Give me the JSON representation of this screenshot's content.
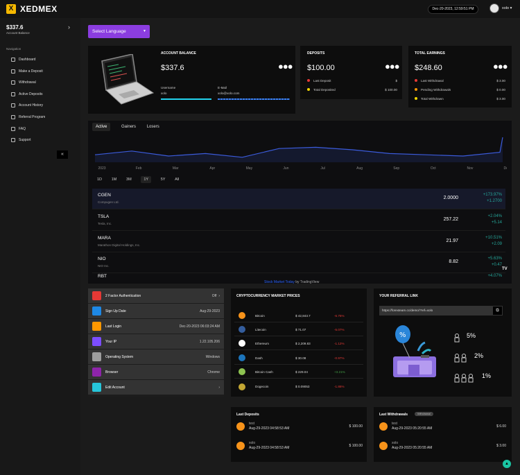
{
  "brand": {
    "name": "XEDMEX",
    "logo_letter": "X"
  },
  "header": {
    "datetime": "Dec-20-2023, 12:59:51 PM",
    "username": "xolo",
    "caret": "▾"
  },
  "sidebar": {
    "balance": "$337.6",
    "balance_label": "Account Balance",
    "nav_heading": "Navigation",
    "items": [
      {
        "label": "Dashboard",
        "icon": "dashboard-icon"
      },
      {
        "label": "Make a Deposit",
        "icon": "deposit-icon"
      },
      {
        "label": "Withdrawal",
        "icon": "withdrawal-icon"
      },
      {
        "label": "Active Deposits",
        "icon": "active-deposits-icon"
      },
      {
        "label": "Account History",
        "icon": "history-icon"
      },
      {
        "label": "Referral Program",
        "icon": "referral-icon"
      },
      {
        "label": "FAQ",
        "icon": "faq-icon"
      },
      {
        "label": "Support",
        "icon": "support-icon"
      }
    ],
    "collapse": "«"
  },
  "language": {
    "label": "Select Language"
  },
  "account_card": {
    "title": "ACCOUNT BALANCE",
    "amount": "$337.6",
    "user_label": "Username",
    "user_value": "xolo",
    "email_label": "E-Mail",
    "email_value": "xolo@xolo.com"
  },
  "deposits_card": {
    "title": "DEPOSITS",
    "amount": "$100.00",
    "rows": [
      {
        "label": "Last Deposit",
        "value": "$",
        "color": "#e53935"
      },
      {
        "label": "Total Deposited",
        "value": "$ 100.00",
        "color": "#f5d800"
      }
    ]
  },
  "earnings_card": {
    "title": "TOTAL EARNINGS",
    "amount": "$248.60",
    "rows": [
      {
        "label": "Last Withdrawal",
        "value": "$ 3.00",
        "color": "#e53935"
      },
      {
        "label": "Pending Withdrawals",
        "value": "$ 0.00",
        "color": "#ff9800"
      },
      {
        "label": "Total Withdrawn",
        "value": "$ 3.00",
        "color": "#f5d800"
      }
    ]
  },
  "market": {
    "tabs": [
      "Active",
      "Gainers",
      "Losers"
    ],
    "months": [
      "2023",
      "Feb",
      "Mar",
      "Apr",
      "May",
      "Jun",
      "Jul",
      "Aug",
      "Sep",
      "Oct",
      "Nov",
      "Dec"
    ],
    "ranges": [
      "1D",
      "1M",
      "3M",
      "1Y",
      "5Y",
      "All"
    ],
    "stocks": [
      {
        "symbol": "CGEN",
        "name": "Compugen Ltd.",
        "price": "2.0000",
        "pct": "+173.97%",
        "chg": "+1.2700"
      },
      {
        "symbol": "TSLA",
        "name": "Tesla, Inc.",
        "price": "257.22",
        "pct": "+2.04%",
        "chg": "+5.14"
      },
      {
        "symbol": "MARA",
        "name": "Marathon Digital Holdings, Inc.",
        "price": "21.97",
        "pct": "+10.51%",
        "chg": "+2.09"
      },
      {
        "symbol": "NIO",
        "name": "NIO Inc.",
        "price": "8.82",
        "pct": "+5.63%",
        "chg": "+0.47"
      },
      {
        "symbol": "RBT",
        "name": "",
        "price": "",
        "pct": "+4.07%",
        "chg": ""
      }
    ],
    "footer_link": "Stock Market Today",
    "footer_by": "by TradingView"
  },
  "chart_data": {
    "type": "area",
    "x": [
      "2023",
      "Feb",
      "Mar",
      "Apr",
      "May",
      "Jun",
      "Jul",
      "Aug",
      "Sep",
      "Oct",
      "Nov",
      "Dec"
    ],
    "series": [
      {
        "values": [
          0.3,
          0.45,
          0.25,
          0.35,
          0.2,
          0.55,
          0.6,
          0.5,
          0.35,
          0.3,
          0.25,
          0.4
        ]
      }
    ],
    "end_spike": 1.0,
    "color": "#3b5bdb"
  },
  "info": [
    {
      "label": "2 Factor Authentication",
      "value": "Off",
      "color": "#e53935",
      "icon": "shield-icon"
    },
    {
      "label": "Sign Up Date",
      "value": "Aug-29-2023",
      "color": "#1e88e5",
      "icon": "calendar-icon"
    },
    {
      "label": "Last Login",
      "value": "Dec-20-2023 06:03:24 AM",
      "color": "#ff9800",
      "icon": "clock-icon"
    },
    {
      "label": "Your IP",
      "value": "1.22.105.206",
      "color": "#7c4dff",
      "icon": "wifi-icon"
    },
    {
      "label": "Operating System",
      "value": "Windows",
      "color": "#9e9e9e",
      "icon": "windows-icon"
    },
    {
      "label": "Browser",
      "value": "Chrome",
      "color": "#8e24aa",
      "icon": "browser-icon"
    },
    {
      "label": "Edit Account",
      "value": "",
      "color": "#26c6da",
      "icon": "gear-icon"
    }
  ],
  "crypto": {
    "title": "CRYPTOCURRENCY MARKET PRICES",
    "rows": [
      {
        "name": "Bitcoin",
        "price": "$ 42,843.7",
        "change": "-6.75%",
        "color": "#f7931a",
        "up": false
      },
      {
        "name": "Litecoin",
        "price": "$ 71.07",
        "change": "-5.07%",
        "color": "#345d9d",
        "up": false
      },
      {
        "name": "Ethereum",
        "price": "$ 2,209.83",
        "change": "-1.12%",
        "color": "#ffffff",
        "up": false
      },
      {
        "name": "Dash",
        "price": "$ 30.08",
        "change": "-0.97%",
        "color": "#1c75bc",
        "up": false
      },
      {
        "name": "Bitcoin Cash",
        "price": "$ 229.04",
        "change": "+3.21%",
        "color": "#8dc351",
        "up": true
      },
      {
        "name": "Dogecoin",
        "price": "$ 0.09053",
        "change": "-1.86%",
        "color": "#c2a633",
        "up": false
      }
    ]
  },
  "referral": {
    "title": "YOUR REFERRAL LINK",
    "link": "https://forexteam.cc/demo/?ref=xolo",
    "tiers": [
      "5%",
      "2%",
      "1%"
    ]
  },
  "last_deposits": {
    "title": "Last Deposits",
    "rows": [
      {
        "user": "test",
        "date": "Aug-29-2023 04:58:53 AM",
        "amount": "$ 100.00"
      },
      {
        "user": "xolo",
        "date": "Aug-29-2023 04:58:53 AM",
        "amount": "$ 100.00"
      }
    ]
  },
  "last_withdrawals": {
    "title": "Last Withdrawals",
    "badge": "Withdrawal",
    "rows": [
      {
        "user": "test",
        "date": "Aug-29-2023 05:20:55 AM",
        "amount": "$ 6.00"
      },
      {
        "user": "xolo",
        "date": "Aug-29-2023 05:20:55 AM",
        "amount": "$ 3.00"
      }
    ]
  }
}
